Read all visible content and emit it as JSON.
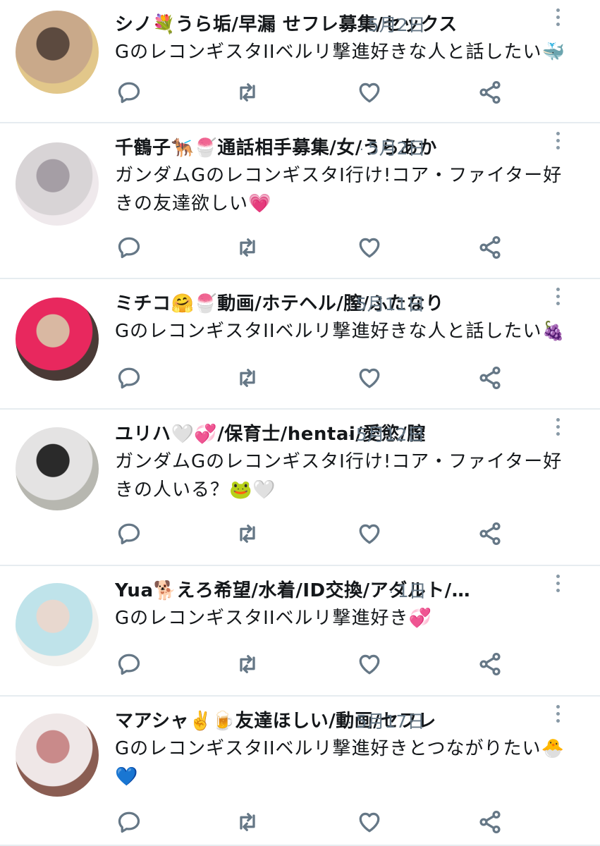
{
  "timeline": [
    {
      "name": "シノ💐うら垢/早漏 せフレ募集/セックス",
      "time": "5月2日",
      "text": "GのレコンギスタIIベルリ撃進好きな人と話したい🐳",
      "avatar_colors": [
        "#c9a98a",
        "#5c4a3f",
        "#e2c78a"
      ]
    },
    {
      "name": "千鶴子🐕‍🦺🍧通話相手募集/女/うらあか",
      "time": "5月2日",
      "text": "ガンダムGのレコンギスタI行け!コア・ファイター好きの友達欲しい💗",
      "avatar_colors": [
        "#d8d4d6",
        "#a59ea5",
        "#efe9ec"
      ]
    },
    {
      "name": "ミチコ🤗🍧動画/ホテヘル/膣/ふたなり",
      "time": "5月11日",
      "text": "GのレコンギスタIIベルリ撃進好きな人と話したい🍇",
      "avatar_colors": [
        "#e8285e",
        "#d9b8a2",
        "#4a3a36"
      ]
    },
    {
      "name": "ユリハ🤍💞/保育士/hentai/愛慾/膣",
      "time": "5月12日",
      "text": "ガンダムGのレコンギスタI行け!コア・ファイター好きの人いる？🐸🤍",
      "avatar_colors": [
        "#e4e3e3",
        "#2a2a2a",
        "#b7b7b0"
      ]
    },
    {
      "name": "Yua🐕えろ希望/水着/ID交換/アダルト/ポルノ",
      "time": "1日",
      "text": "GのレコンギスタIIベルリ撃進好き💞",
      "avatar_colors": [
        "#bfe3ea",
        "#e8d8cf",
        "#f3f1ee"
      ]
    },
    {
      "name": "マアシャ✌️🍺友達ほしい/動画/セフレ",
      "time": "5月17日",
      "text": "GのレコンギスタIIベルリ撃進好きとつながりたい🐣💙",
      "avatar_colors": [
        "#efe7e7",
        "#c98a8a",
        "#8a5d52"
      ]
    }
  ],
  "icons": {
    "more": "more-vertical-icon",
    "reply": "reply-icon",
    "retweet": "retweet-icon",
    "like": "heart-icon",
    "share": "share-icon"
  },
  "colors": {
    "text": "#14171a",
    "secondary": "#657786",
    "divider": "#e6ecf0"
  }
}
